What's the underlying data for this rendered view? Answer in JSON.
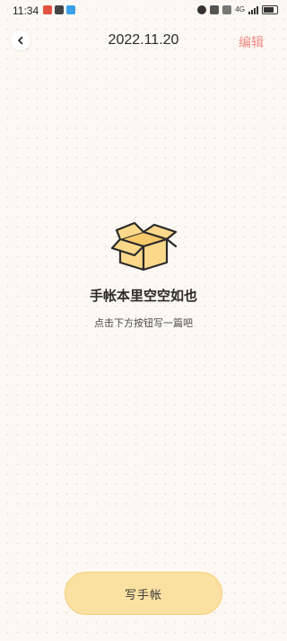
{
  "status_bar": {
    "time": "11:34",
    "left_icons": [
      "notification-app-icon",
      "listen-app-icon",
      "cloud-app-icon"
    ],
    "network_label": "4G",
    "battery_icon": "battery-icon"
  },
  "header": {
    "title": "2022.11.20",
    "edit_label": "编辑",
    "back_icon": "chevron-left-icon"
  },
  "empty_state": {
    "icon": "open-box-icon",
    "title": "手帐本里空空如也",
    "subtitle": "点击下方按钮写一篇吧"
  },
  "footer": {
    "write_button_label": "写手帐"
  },
  "colors": {
    "background": "#fdf8f3",
    "accent_edit": "#f08a82",
    "button_fill": "#fbe1a1",
    "box_fill": "#fcd98a"
  }
}
